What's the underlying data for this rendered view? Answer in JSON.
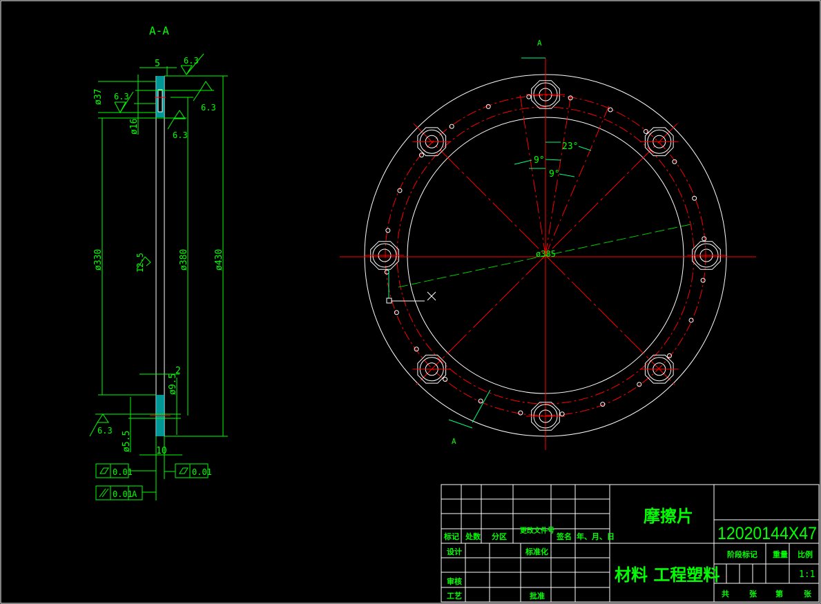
{
  "section": {
    "title": "A-A",
    "dims": {
      "w5": "5",
      "d37": "ø37",
      "d16": "ø16",
      "d330": "ø330",
      "d380": "ø380",
      "d430": "ø430",
      "d9_5": "ø9.5",
      "d5_5": "ø5.5",
      "w2": "2",
      "w10": "10"
    },
    "roughness": [
      "6.3",
      "6.3",
      "6.3",
      "6.3",
      "6.3",
      "12.5"
    ],
    "tolerances": [
      {
        "symbol": "flatness-icon",
        "value": "0.01"
      },
      {
        "symbol": "flatness-icon",
        "value": "0.01"
      },
      {
        "symbol": "parallelism-icon",
        "value": "0.01",
        "datum": "A"
      }
    ]
  },
  "plan": {
    "section_mark": "A",
    "angles": [
      "23°",
      "9°",
      "9°"
    ],
    "bolt_circle": "ø385",
    "big_holes": 8,
    "small_holes": 24
  },
  "title_block": {
    "part_name": "摩擦片",
    "drawing_no": "12020144X47",
    "material": "材料 工程塑料",
    "rev_headers": [
      "标记",
      "处数",
      "分区",
      "更改文件号",
      "签名",
      "年、月、日"
    ],
    "roles": [
      "设计",
      "标准化",
      "审核",
      "工艺",
      "批准"
    ],
    "stage_label": "阶段标记",
    "weight_label": "重量",
    "scale_label": "比例",
    "scale": "1:1",
    "sheet": [
      "共",
      "张",
      "第",
      "张"
    ]
  },
  "colors": {
    "dim": "#00ff00",
    "center": "#ff0000",
    "outline": "#ffffff",
    "hatch": "#00cccc"
  }
}
